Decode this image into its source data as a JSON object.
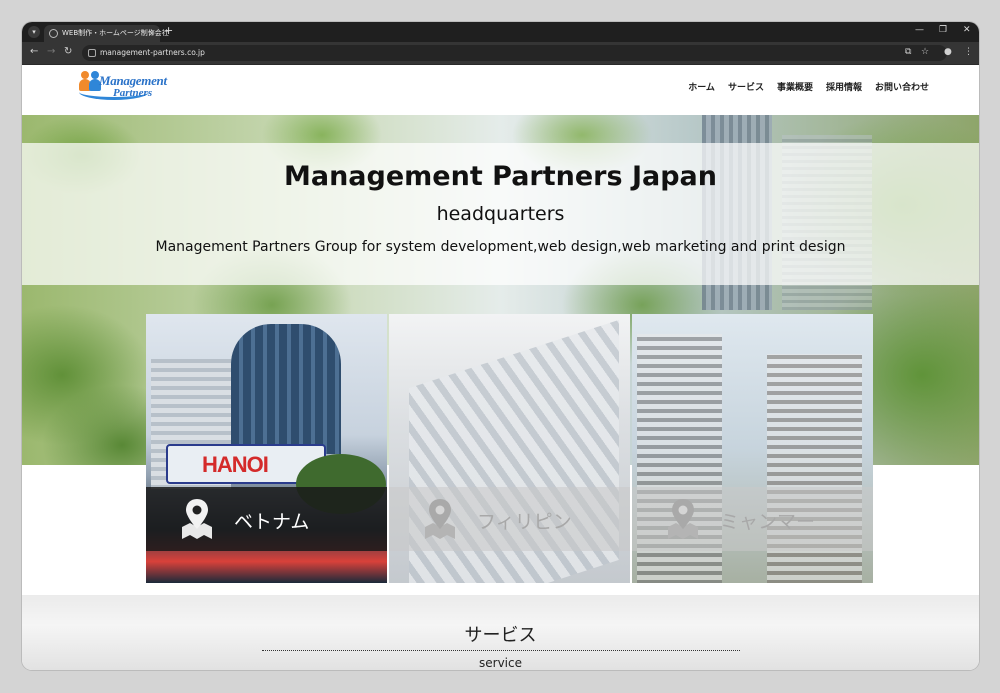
{
  "browser": {
    "tab_title": "WEB制作・ホームページ制作会社",
    "address": "management-partners.co.jp"
  },
  "logo": {
    "line1": "Management",
    "line2": "Partners"
  },
  "nav": {
    "items": [
      "ホーム",
      "サービス",
      "事業概要",
      "採用情報",
      "お問い合わせ"
    ]
  },
  "hero": {
    "title": "Management Partners Japan",
    "subtitle": "headquarters",
    "tagline": "Management Partners Group for system development,web design,web marketing and print design"
  },
  "locations": [
    {
      "name": "ベトナム",
      "sign": "HANOI",
      "active": true
    },
    {
      "name": "フィリピン",
      "active": false
    },
    {
      "name": "ミャンマー",
      "active": false
    }
  ],
  "service": {
    "title": "サービス",
    "subtitle": "service"
  },
  "icons": {
    "map_pin": "map-pin-icon",
    "bookmark": "star-icon",
    "profile": "profile-icon"
  }
}
